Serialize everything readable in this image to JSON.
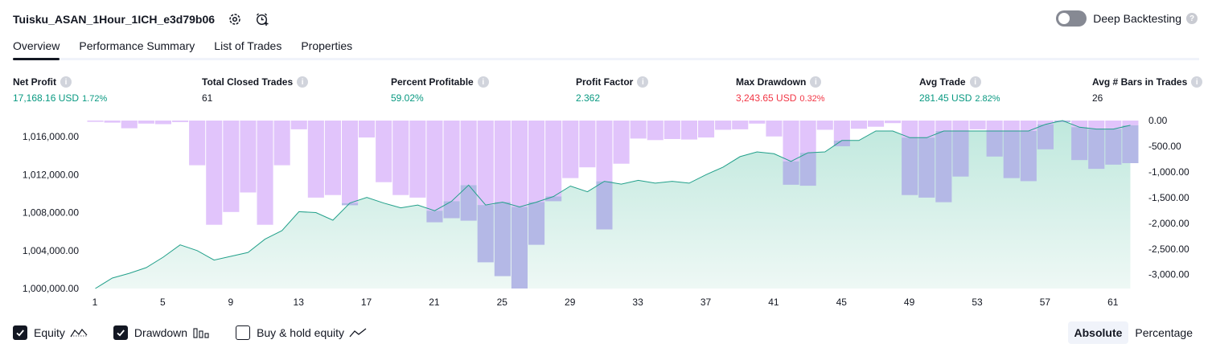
{
  "header": {
    "title": "Tuisku_ASAN_1Hour_1ICH_e3d79b06",
    "settings_icon": "gear-icon",
    "alert_icon": "add-alert-icon"
  },
  "deep_backtesting": {
    "label": "Deep Backtesting",
    "enabled": false,
    "help": "?"
  },
  "tabs": [
    {
      "label": "Overview",
      "active": true
    },
    {
      "label": "Performance Summary",
      "active": false
    },
    {
      "label": "List of Trades",
      "active": false
    },
    {
      "label": "Properties",
      "active": false
    }
  ],
  "metrics": {
    "net_profit": {
      "label": "Net Profit",
      "value": "17,168.16 USD",
      "pct": "1.72%"
    },
    "total_closed_trades": {
      "label": "Total Closed Trades",
      "value": "61"
    },
    "percent_profitable": {
      "label": "Percent Profitable",
      "value": "59.02%"
    },
    "profit_factor": {
      "label": "Profit Factor",
      "value": "2.362"
    },
    "max_drawdown": {
      "label": "Max Drawdown",
      "value": "3,243.65 USD",
      "pct": "0.32%"
    },
    "avg_trade": {
      "label": "Avg Trade",
      "value": "281.45 USD",
      "pct": "2.82%"
    },
    "avg_bars": {
      "label": "Avg # Bars in Trades",
      "value": "26"
    }
  },
  "colors": {
    "green": "#089981",
    "red": "#f23645",
    "equity_line": "#22a08a",
    "equity_fill_top": "#bfe8dd",
    "equity_fill_bottom": "#eef8f5",
    "drawdown_bar": "#e1c4fb",
    "overlap_bar": "#b4b8e6"
  },
  "chart_data": {
    "type": "area",
    "x_ticks": [
      1,
      5,
      9,
      13,
      17,
      21,
      25,
      29,
      33,
      37,
      41,
      45,
      49,
      53,
      57,
      61
    ],
    "equity_axis": {
      "ticks": [
        1000000,
        1004000,
        1008000,
        1012000,
        1016000
      ],
      "tick_labels": [
        "1,000,000.00",
        "1,004,000.00",
        "1,008,000.00",
        "1,012,000.00",
        "1,016,000.00"
      ],
      "ylim": [
        1000000,
        1017700
      ]
    },
    "drawdown_axis": {
      "ticks": [
        0,
        -500,
        -1000,
        -1500,
        -2000,
        -2500,
        -3000
      ],
      "tick_labels": [
        "0.00",
        "-500.00",
        "-1,000.00",
        "-1,500.00",
        "-2,000.00",
        "-2,500.00",
        "-3,000.00"
      ],
      "ylim": [
        -3270,
        0
      ]
    },
    "series": [
      {
        "name": "Equity",
        "x": [
          1,
          2,
          3,
          4,
          5,
          6,
          7,
          8,
          9,
          10,
          11,
          12,
          13,
          14,
          15,
          16,
          17,
          18,
          19,
          20,
          21,
          22,
          23,
          24,
          25,
          26,
          27,
          28,
          29,
          30,
          31,
          32,
          33,
          34,
          35,
          36,
          37,
          38,
          39,
          40,
          41,
          42,
          43,
          44,
          45,
          46,
          47,
          48,
          49,
          50,
          51,
          52,
          53,
          54,
          55,
          56,
          57,
          58,
          59,
          60,
          61,
          62
        ],
        "values": [
          1000000,
          1001100,
          1001600,
          1002200,
          1003300,
          1004600,
          1004000,
          1003000,
          1003400,
          1003800,
          1005200,
          1006100,
          1008100,
          1008000,
          1007200,
          1009000,
          1009600,
          1009000,
          1008500,
          1008800,
          1008200,
          1009200,
          1010900,
          1008800,
          1009100,
          1008600,
          1009100,
          1009700,
          1010800,
          1010200,
          1011300,
          1011000,
          1011400,
          1011100,
          1011300,
          1011100,
          1012000,
          1012800,
          1013900,
          1014400,
          1014200,
          1013400,
          1014300,
          1014400,
          1015600,
          1015600,
          1016600,
          1016600,
          1015900,
          1015900,
          1016600,
          1016600,
          1016600,
          1016600,
          1016600,
          1016600,
          1017300,
          1017700,
          1017000,
          1016800,
          1016800,
          1017200
        ]
      },
      {
        "name": "Drawdown",
        "x": [
          1,
          2,
          3,
          4,
          5,
          6,
          7,
          8,
          9,
          10,
          11,
          12,
          13,
          14,
          15,
          16,
          17,
          18,
          19,
          20,
          21,
          22,
          23,
          24,
          25,
          26,
          27,
          28,
          29,
          30,
          31,
          32,
          33,
          34,
          35,
          36,
          37,
          38,
          39,
          40,
          41,
          42,
          43,
          44,
          45,
          46,
          47,
          48,
          49,
          50,
          51,
          52,
          53,
          54,
          55,
          56,
          57,
          58,
          59,
          60,
          61,
          62
        ],
        "values": [
          -25,
          -40,
          -150,
          -60,
          -70,
          -30,
          -870,
          -2030,
          -1780,
          -1400,
          -2030,
          -870,
          -170,
          -1500,
          -1450,
          -1650,
          -330,
          -1200,
          -1450,
          -1500,
          -1980,
          -1900,
          -1950,
          -2760,
          -3030,
          -3270,
          -2420,
          -1570,
          -1120,
          -910,
          -2120,
          -840,
          -350,
          -380,
          -360,
          -370,
          -330,
          -180,
          -170,
          -60,
          -310,
          -1250,
          -1270,
          -180,
          -500,
          -160,
          -120,
          -50,
          -1450,
          -1500,
          -1590,
          -1090,
          -170,
          -700,
          -1120,
          -1180,
          -560,
          -30,
          -770,
          -940,
          -860,
          -830
        ]
      }
    ]
  },
  "legend": [
    {
      "label": "Equity",
      "checked": true,
      "icon": "equity-line-icon"
    },
    {
      "label": "Drawdown",
      "checked": true,
      "icon": "drawdown-bars-icon"
    },
    {
      "label": "Buy & hold equity",
      "checked": false,
      "icon": "buy-hold-line-icon"
    }
  ],
  "view_mode": {
    "options": [
      "Absolute",
      "Percentage"
    ],
    "selected": "Absolute"
  }
}
